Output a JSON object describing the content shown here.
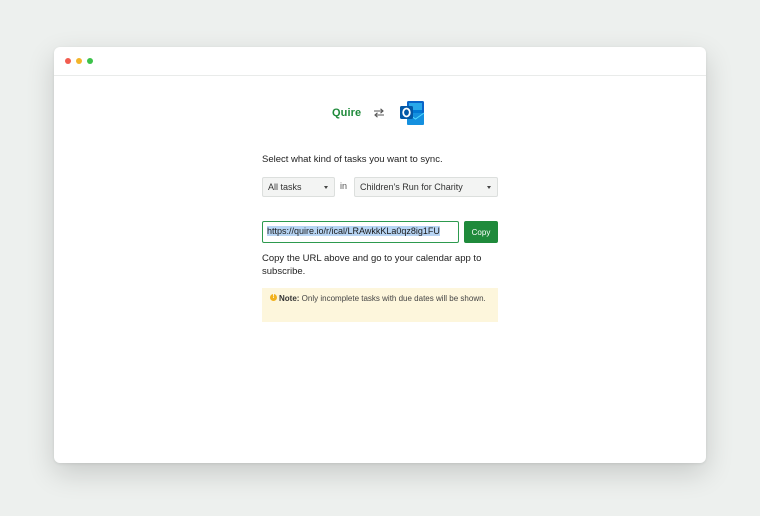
{
  "brand": {
    "quire_label": "Quire"
  },
  "icons": {
    "swap": "swap-arrows-icon",
    "outlook": "outlook-icon",
    "warning": "warning-icon"
  },
  "instruction": "Select what kind of tasks you want to sync.",
  "filters": {
    "scope_value": "All tasks",
    "in_label": "in",
    "project_value": "Children's Run for Charity"
  },
  "url_field": {
    "value": "https://quire.io/r/ical/LRAwkkKLa0qz8ig1FU"
  },
  "copy_button": {
    "label": "Copy"
  },
  "copy_instructions": "Copy the URL above and go to your calendar app to subscribe.",
  "note": {
    "label": "Note:",
    "text": " Only incomplete tasks with due dates will be shown."
  },
  "colors": {
    "accent": "#1f8a3b",
    "note_bg": "#fdf6dc",
    "selection": "#b7d4f3",
    "outlook_blue": "#0a64c8"
  }
}
